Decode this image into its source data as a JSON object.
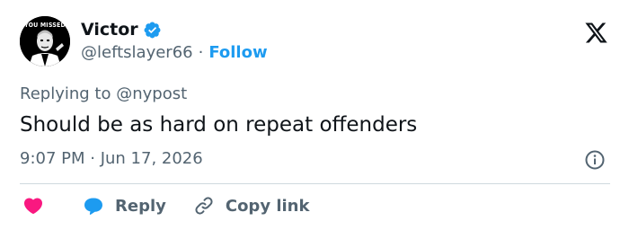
{
  "author": {
    "avatar_text": "YOU MISSED",
    "display_name": "Victor",
    "handle": "@leftslayer66",
    "separator": "·",
    "follow_label": "Follow",
    "verified_icon": "verified-badge-icon"
  },
  "reply_context": {
    "prefix": "Replying to",
    "mention": "@nypost"
  },
  "tweet": {
    "text": "Should be as hard on repeat offenders",
    "timestamp": "9:07 PM · Jun 17, 2026"
  },
  "actions": {
    "reply_label": "Reply",
    "copy_link_label": "Copy link"
  },
  "colors": {
    "accent": "#1d9bf0",
    "heart": "#f91880",
    "text": "#0f1419",
    "muted": "#536471",
    "divider": "#cfd9de"
  },
  "icons": [
    "x-logo-icon",
    "verified-badge-icon",
    "info-icon",
    "heart-icon",
    "reply-bubble-icon",
    "link-icon"
  ]
}
